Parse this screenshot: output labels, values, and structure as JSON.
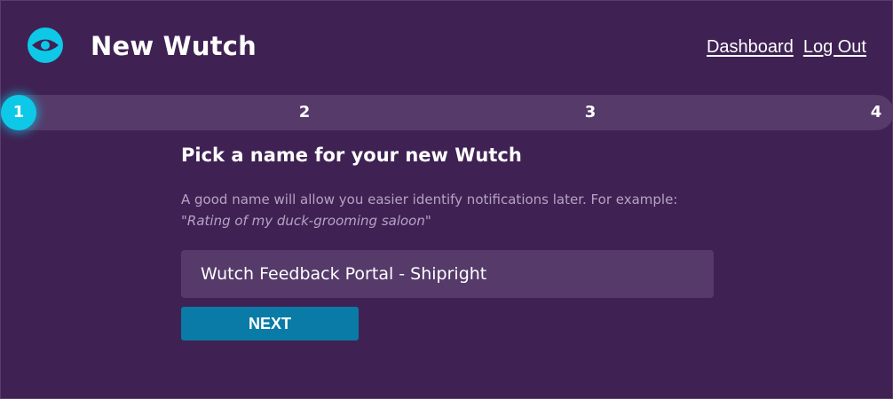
{
  "header": {
    "logo_icon": "eye-icon",
    "title": "New Wutch",
    "nav": {
      "dashboard": "Dashboard",
      "logout": "Log Out"
    }
  },
  "stepper": {
    "steps": [
      "1",
      "2",
      "3",
      "4"
    ],
    "active_step": 1
  },
  "form": {
    "heading": "Pick a name for your new Wutch",
    "hint": "A good name will allow you easier identify notifications later. For example:",
    "example": "\"Rating of my duck-grooming saloon\"",
    "name_value": "Wutch Feedback Portal - Shipright",
    "next_label": "NEXT"
  },
  "colors": {
    "background": "#3f2253",
    "surface": "#563a6a",
    "accent": "#0ec8e8",
    "button": "#0a7ba6"
  }
}
